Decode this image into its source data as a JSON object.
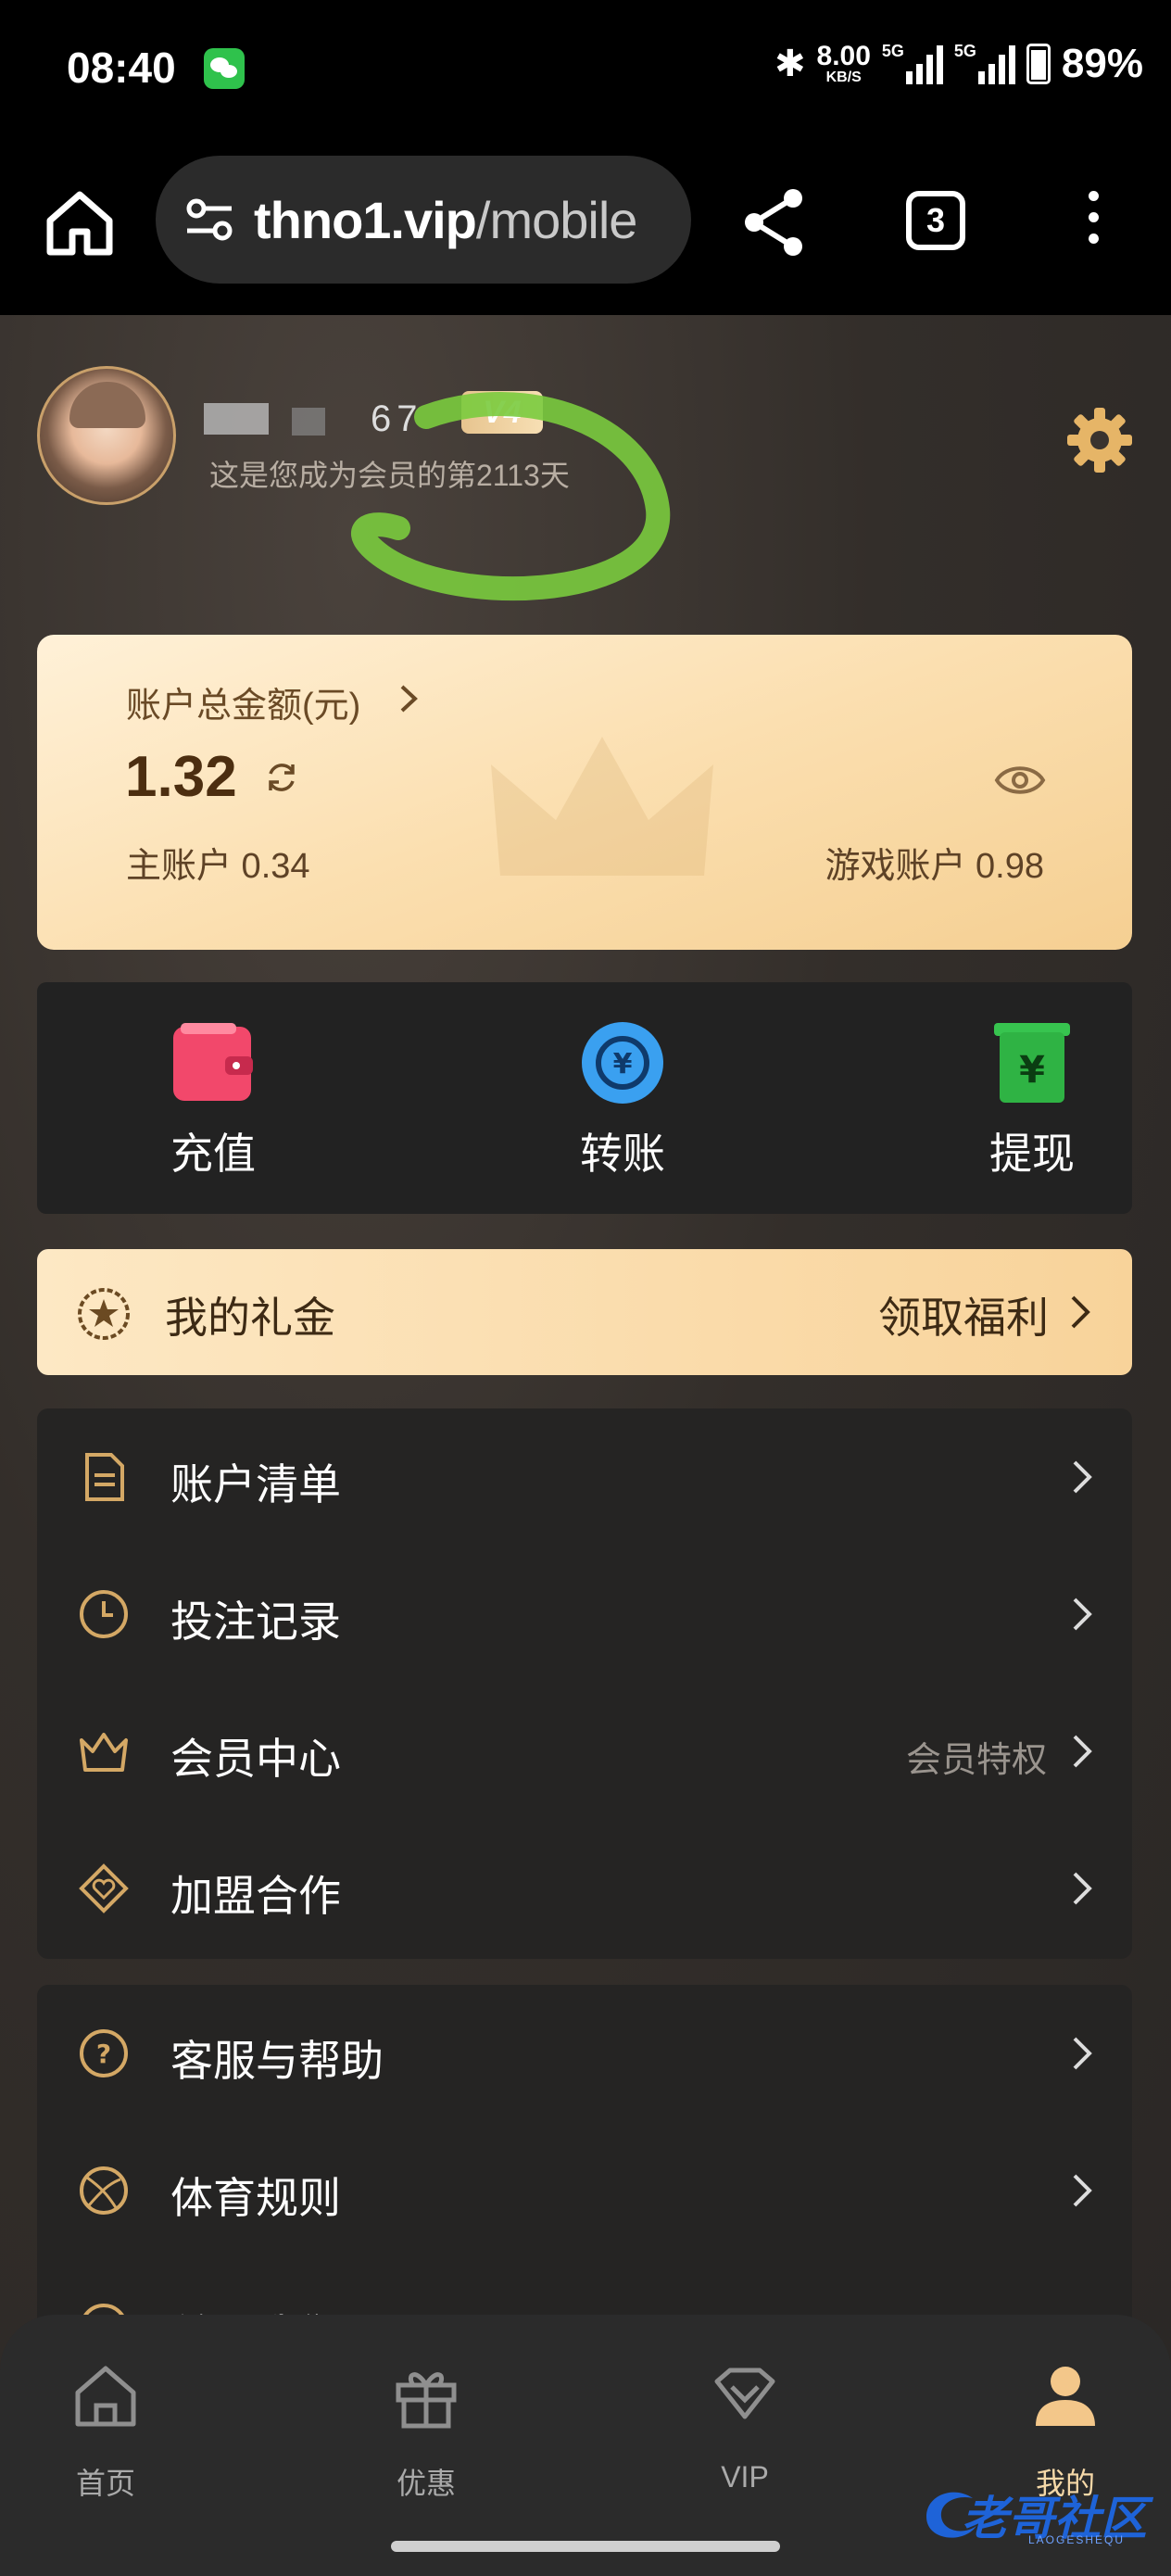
{
  "status_bar": {
    "time": "08:40",
    "net_speed": "8.00",
    "net_unit": "KB/S",
    "sim1": "5G",
    "sim2": "5G",
    "battery": "89%",
    "icons": [
      "wechat-icon",
      "bluetooth-icon",
      "signal-icon",
      "battery-icon"
    ]
  },
  "browser": {
    "url_host": "thno1.vip",
    "url_path": "/mobile",
    "tab_count": "3"
  },
  "profile": {
    "name_suffix": "67",
    "vip_badge": "V4",
    "member_days_text": "这是您成为会员的第2113天"
  },
  "balance": {
    "title": "账户总金额(元)",
    "total": "1.32",
    "main_account": "主账户 0.34",
    "game_account": "游戏账户 0.98"
  },
  "actions": [
    {
      "label": "充值",
      "icon": "wallet-icon",
      "color": "#f2486b"
    },
    {
      "label": "转账",
      "icon": "transfer-icon",
      "color": "#3aa0f0"
    },
    {
      "label": "提现",
      "icon": "withdraw-icon",
      "color": "#2fb344"
    }
  ],
  "gift": {
    "label": "我的礼金",
    "claim": "领取福利"
  },
  "menu_group1": [
    {
      "label": "账户清单",
      "icon": "document-icon",
      "sub": ""
    },
    {
      "label": "投注记录",
      "icon": "clock-icon",
      "sub": ""
    },
    {
      "label": "会员中心",
      "icon": "crown-icon",
      "sub": "会员特权"
    },
    {
      "label": "加盟合作",
      "icon": "diamond-heart-icon",
      "sub": ""
    }
  ],
  "menu_group2": [
    {
      "label": "客服与帮助",
      "icon": "question-icon",
      "sub": ""
    },
    {
      "label": "体育规则",
      "icon": "ball-icon",
      "sub": ""
    },
    {
      "label": "关于我们",
      "icon": "info-icon",
      "sub": ""
    }
  ],
  "tabbar": [
    {
      "label": "首页",
      "icon": "home-icon"
    },
    {
      "label": "优惠",
      "icon": "gift-box-icon"
    },
    {
      "label": "VIP",
      "icon": "vip-diamond-icon"
    },
    {
      "label": "我的",
      "icon": "user-icon"
    }
  ],
  "watermark": {
    "text": "老哥社区",
    "sub": "LAOGESHEQU"
  },
  "colors": {
    "accent_gold": "#c9a06a",
    "card_bg": "#252423",
    "balance_bg": "#fbdfb0"
  }
}
